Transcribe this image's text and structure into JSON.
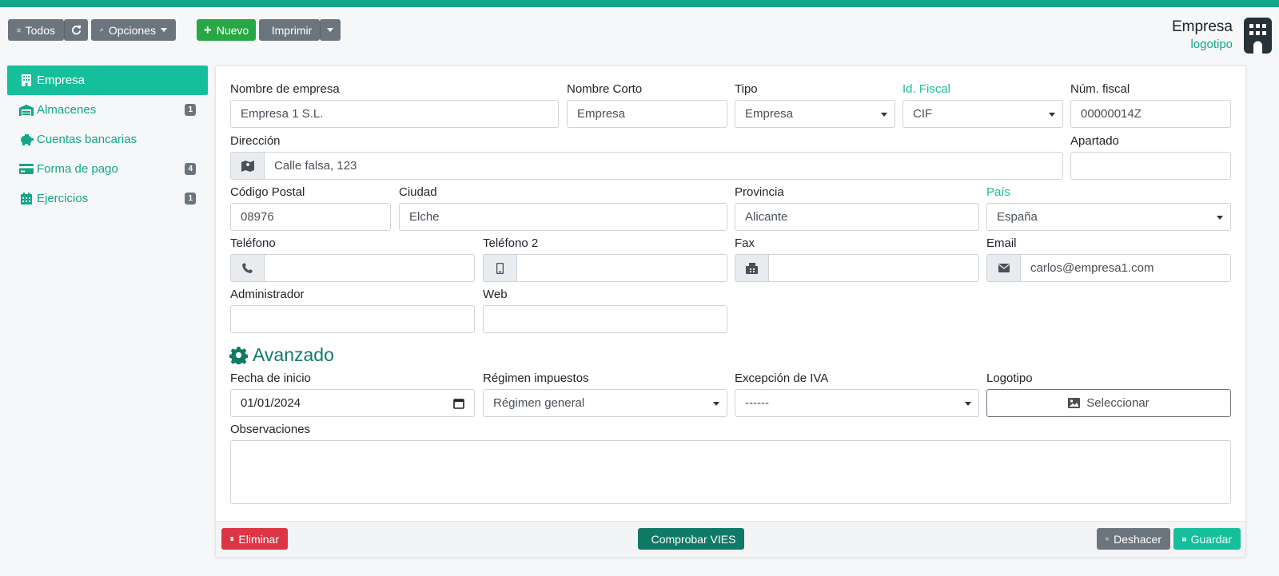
{
  "toolbar": {
    "all_label": "Todos",
    "options_label": "Opciones",
    "new_label": "Nuevo",
    "print_label": "Imprimir"
  },
  "header": {
    "title": "Empresa",
    "subtitle": "logotipo"
  },
  "sidebar": {
    "items": [
      {
        "label": "Empresa",
        "icon": "building-icon",
        "badge": ""
      },
      {
        "label": "Almacenes",
        "icon": "warehouse-icon",
        "badge": "1"
      },
      {
        "label": "Cuentas bancarias",
        "icon": "piggy-bank-icon",
        "badge": ""
      },
      {
        "label": "Forma de pago",
        "icon": "credit-card-icon",
        "badge": "4"
      },
      {
        "label": "Ejercicios",
        "icon": "calendar-icon",
        "badge": "1"
      }
    ]
  },
  "form": {
    "company_name": {
      "label": "Nombre de empresa",
      "value": "Empresa 1 S.L."
    },
    "short_name": {
      "label": "Nombre Corto",
      "value": "Empresa"
    },
    "type": {
      "label": "Tipo",
      "value": "Empresa"
    },
    "fiscal_id": {
      "label": "Id. Fiscal",
      "value": "CIF"
    },
    "fiscal_number": {
      "label": "Núm. fiscal",
      "value": "00000014Z"
    },
    "address": {
      "label": "Dirección",
      "value": "Calle falsa, 123"
    },
    "po_box": {
      "label": "Apartado",
      "value": ""
    },
    "postal_code": {
      "label": "Código Postal",
      "value": "08976"
    },
    "city": {
      "label": "Ciudad",
      "value": "Elche"
    },
    "province": {
      "label": "Provincia",
      "value": "Alicante"
    },
    "country": {
      "label": "País",
      "value": "España"
    },
    "phone": {
      "label": "Teléfono",
      "value": ""
    },
    "phone2": {
      "label": "Teléfono 2",
      "value": ""
    },
    "fax": {
      "label": "Fax",
      "value": ""
    },
    "email": {
      "label": "Email",
      "value": "carlos@empresa1.com"
    },
    "admin": {
      "label": "Administrador",
      "value": ""
    },
    "web": {
      "label": "Web",
      "value": ""
    }
  },
  "advanced": {
    "title": "Avanzado",
    "start_date": {
      "label": "Fecha de inicio",
      "value": "01/01/2024"
    },
    "tax_regime": {
      "label": "Régimen impuestos",
      "value": "Régimen general"
    },
    "vat_exception": {
      "label": "Excepción de IVA",
      "value": "------"
    },
    "logo": {
      "label": "Logotipo",
      "button": "Seleccionar"
    },
    "notes": {
      "label": "Observaciones",
      "value": ""
    }
  },
  "footer": {
    "delete_label": "Eliminar",
    "vies_label": "Comprobar VIES",
    "undo_label": "Deshacer",
    "save_label": "Guardar"
  },
  "colors": {
    "accent": "#15bf9b",
    "accent_dark": "#0f7b66",
    "danger": "#dc3545",
    "success": "#28a745"
  }
}
